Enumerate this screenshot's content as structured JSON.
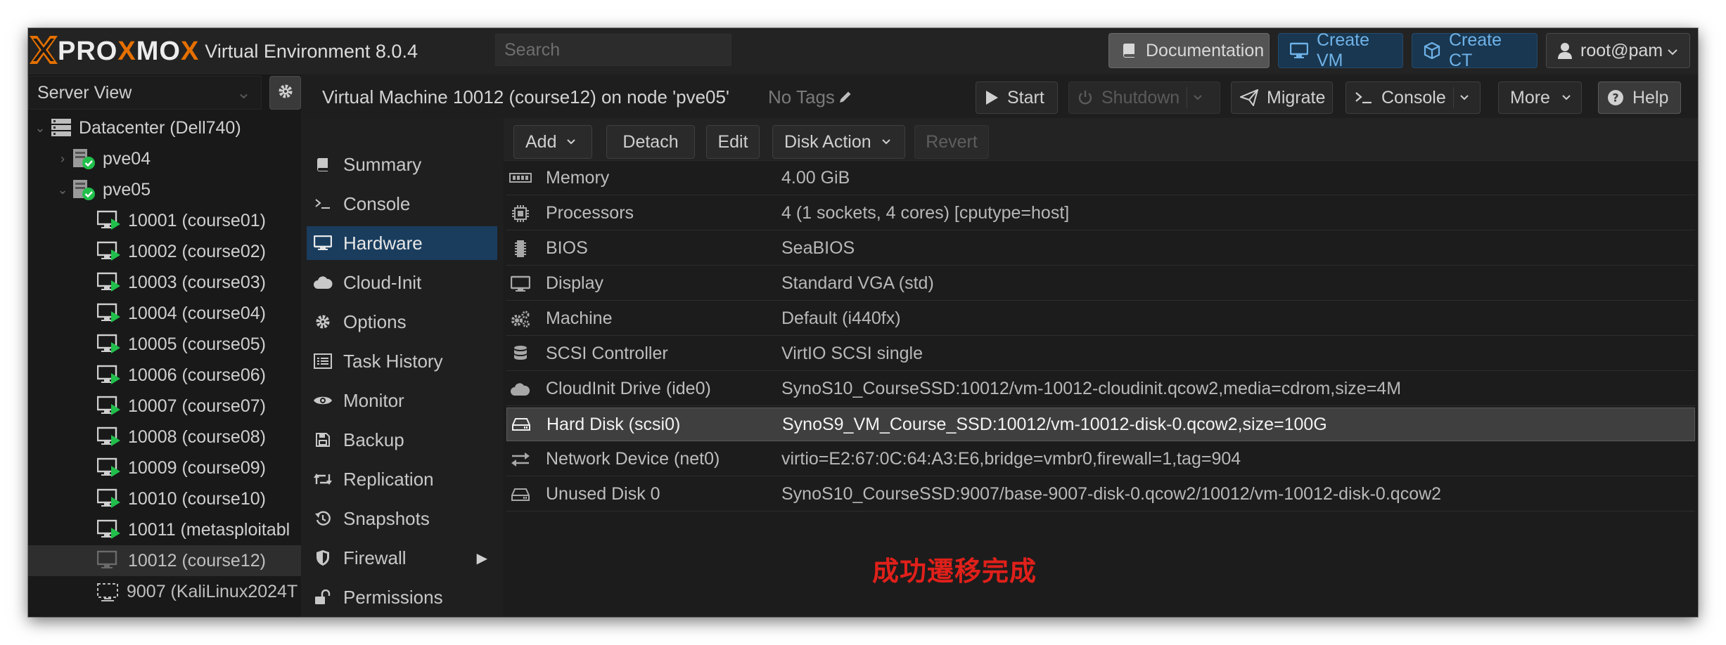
{
  "topbar": {
    "logo_part1": "PRO",
    "logo_x": "X",
    "logo_part2": "MO",
    "logo_part3": "X",
    "version": "Virtual Environment 8.0.4",
    "search_placeholder": "Search",
    "documentation": "Documentation",
    "create_vm": "Create VM",
    "create_ct": "Create CT",
    "user": "root@pam"
  },
  "tree": {
    "view": "Server View",
    "nodes": [
      {
        "label": "Datacenter (Dell740)"
      },
      {
        "label": "pve04"
      },
      {
        "label": "pve05"
      },
      {
        "label": "10001 (course01)"
      },
      {
        "label": "10002 (course02)"
      },
      {
        "label": "10003 (course03)"
      },
      {
        "label": "10004 (course04)"
      },
      {
        "label": "10005 (course05)"
      },
      {
        "label": "10006 (course06)"
      },
      {
        "label": "10007 (course07)"
      },
      {
        "label": "10008 (course08)"
      },
      {
        "label": "10009 (course09)"
      },
      {
        "label": "10010 (course10)"
      },
      {
        "label": "10011 (metasploitabl"
      },
      {
        "label": "10012 (course12)"
      },
      {
        "label": "9007 (KaliLinux2024T"
      }
    ]
  },
  "header": {
    "title": "Virtual Machine 10012 (course12) on node 'pve05'",
    "tags": "No Tags",
    "start": "Start",
    "shutdown": "Shutdown",
    "migrate": "Migrate",
    "console": "Console",
    "more": "More",
    "help": "Help"
  },
  "subnav": [
    {
      "label": "Summary",
      "icon": "book-icon"
    },
    {
      "label": "Console",
      "icon": "terminal-icon"
    },
    {
      "label": "Hardware",
      "icon": "monitor-icon"
    },
    {
      "label": "Cloud-Init",
      "icon": "cloud-icon"
    },
    {
      "label": "Options",
      "icon": "gear-icon"
    },
    {
      "label": "Task History",
      "icon": "list-icon"
    },
    {
      "label": "Monitor",
      "icon": "eye-icon"
    },
    {
      "label": "Backup",
      "icon": "floppy-icon"
    },
    {
      "label": "Replication",
      "icon": "retweet-icon"
    },
    {
      "label": "Snapshots",
      "icon": "history-icon"
    },
    {
      "label": "Firewall",
      "icon": "shield-icon"
    },
    {
      "label": "Permissions",
      "icon": "unlock-icon"
    }
  ],
  "hardware": {
    "toolbar": {
      "add": "Add",
      "detach": "Detach",
      "edit": "Edit",
      "disk_action": "Disk Action",
      "revert": "Revert"
    },
    "rows": [
      {
        "name": "Memory",
        "value": "4.00 GiB",
        "icon": "memory-icon"
      },
      {
        "name": "Processors",
        "value": "4 (1 sockets, 4 cores) [cputype=host]",
        "icon": "cpu-icon"
      },
      {
        "name": "BIOS",
        "value": "SeaBIOS",
        "icon": "microchip-icon"
      },
      {
        "name": "Display",
        "value": "Standard VGA (std)",
        "icon": "desktop-icon"
      },
      {
        "name": "Machine",
        "value": "Default (i440fx)",
        "icon": "cogs-icon"
      },
      {
        "name": "SCSI Controller",
        "value": "VirtIO SCSI single",
        "icon": "database-icon"
      },
      {
        "name": "CloudInit Drive (ide0)",
        "value": "SynoS10_CourseSSD:10012/vm-10012-cloudinit.qcow2,media=cdrom,size=4M",
        "icon": "cloud-icon"
      },
      {
        "name": "Hard Disk (scsi0)",
        "value": "SynoS9_VM_Course_SSD:10012/vm-10012-disk-0.qcow2,size=100G",
        "icon": "hdd-icon"
      },
      {
        "name": "Network Device (net0)",
        "value": "virtio=E2:67:0C:64:A3:E6,bridge=vmbr0,firewall=1,tag=904",
        "icon": "exchange-icon"
      },
      {
        "name": "Unused Disk 0",
        "value": "SynoS10_CourseSSD:9007/base-9007-disk-0.qcow2/10012/vm-10012-disk-0.qcow2",
        "icon": "hdd-icon"
      }
    ]
  },
  "annotation": "成功遷移完成",
  "colors": {
    "accent_orange": "#e57000",
    "selected_nav": "#1a3d5e",
    "status_green": "#21bf4b",
    "annotation_red": "#e0201a"
  }
}
